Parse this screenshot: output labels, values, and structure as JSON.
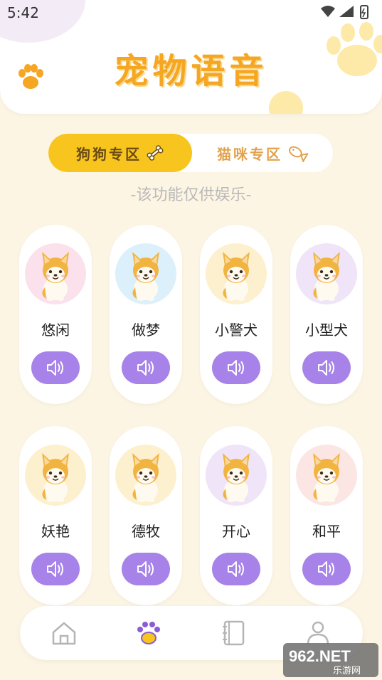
{
  "status_bar": {
    "time": "5:42"
  },
  "app": {
    "title": "宠物语音"
  },
  "tabs": {
    "dog": "狗狗专区",
    "cat": "猫咪专区"
  },
  "disclaimer": "-该功能仅供娱乐-",
  "cards": [
    {
      "label": "悠闲",
      "bg": "#fbe1ec"
    },
    {
      "label": "做梦",
      "bg": "#dcf0fb"
    },
    {
      "label": "小警犬",
      "bg": "#fdf0cf"
    },
    {
      "label": "小型犬",
      "bg": "#efe4f8"
    },
    {
      "label": "妖艳",
      "bg": "#fdf0cf"
    },
    {
      "label": "德牧",
      "bg": "#fdf0cf"
    },
    {
      "label": "开心",
      "bg": "#efe4f8"
    },
    {
      "label": "和平",
      "bg": "#fbe6e4"
    }
  ],
  "colors": {
    "accent": "#f8c51f",
    "title": "#f5a623",
    "button": "#a682e9",
    "background": "#fdf5e4"
  },
  "nav": [
    "home-icon",
    "paw-icon",
    "notebook-icon",
    "profile-icon"
  ],
  "watermark": {
    "brand": "962.NET",
    "sub": "乐游网"
  }
}
